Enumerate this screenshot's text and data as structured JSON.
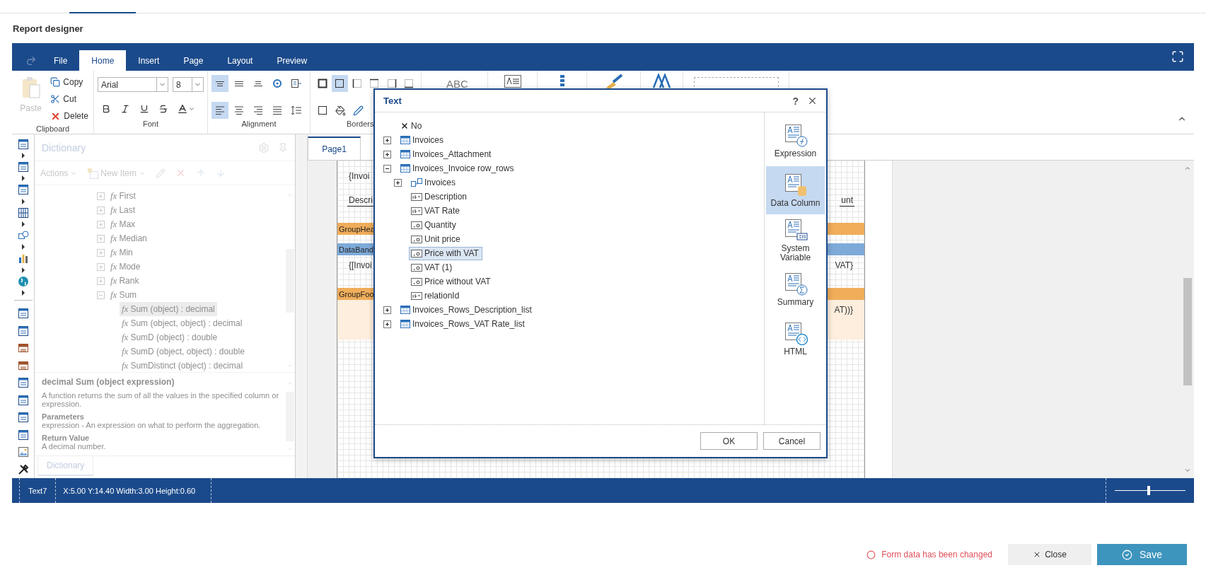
{
  "page_title": "Report designer",
  "ribbon_tabs": [
    {
      "label": "File",
      "selected": false
    },
    {
      "label": "Home",
      "selected": true
    },
    {
      "label": "Insert",
      "selected": false
    },
    {
      "label": "Page",
      "selected": false
    },
    {
      "label": "Layout",
      "selected": false
    },
    {
      "label": "Preview",
      "selected": false
    }
  ],
  "clipboard": {
    "title": "Clipboard",
    "paste": {
      "label": "Paste",
      "disabled": true
    },
    "actions": [
      {
        "kind": "copy",
        "label": "Copy"
      },
      {
        "kind": "cut",
        "label": "Cut"
      },
      {
        "kind": "delete",
        "label": "Delete"
      }
    ]
  },
  "font": {
    "title": "Font",
    "family": "Arial",
    "size": "8",
    "buttons": [
      {
        "kind": "bold",
        "selected": false
      },
      {
        "kind": "italic",
        "selected": false
      },
      {
        "kind": "underline",
        "selected": false
      },
      {
        "kind": "strike",
        "selected": false
      },
      {
        "kind": "color",
        "selected": false
      }
    ]
  },
  "alignment": {
    "title": "Alignment",
    "rows": [
      [
        {
          "kind": "top",
          "selected": true
        },
        {
          "kind": "middle",
          "selected": false
        },
        {
          "kind": "bottom",
          "selected": false
        },
        {
          "kind": "rotate",
          "selected": false
        },
        {
          "kind": "wrap",
          "selected": false
        }
      ],
      [
        {
          "kind": "left",
          "selected": true
        },
        {
          "kind": "center",
          "selected": false
        },
        {
          "kind": "right",
          "selected": false
        },
        {
          "kind": "justify",
          "selected": false
        },
        {
          "kind": "spacing",
          "selected": false
        }
      ]
    ]
  },
  "borders": {
    "title": "Borders",
    "rows": [
      [
        {
          "kind": "all",
          "selected": false
        },
        {
          "kind": "frame",
          "selected": true
        },
        {
          "kind": "left",
          "selected": false
        },
        {
          "kind": "top",
          "selected": false
        },
        {
          "kind": "right",
          "selected": false
        },
        {
          "kind": "bottom",
          "selected": false
        }
      ],
      [
        {
          "kind": "none",
          "selected": false
        },
        {
          "kind": "fill",
          "selected": false
        },
        {
          "kind": "pen",
          "selected": false
        }
      ]
    ]
  },
  "styles": {
    "label": "ABC"
  },
  "dictionary": {
    "title": "Dictionary",
    "actions": "Actions",
    "new_item": "New Item",
    "items": [
      {
        "glyph": "fx",
        "label": "First",
        "expanded": false,
        "selected": false
      },
      {
        "glyph": "fx",
        "label": "Last",
        "expanded": false,
        "selected": false
      },
      {
        "glyph": "fx",
        "label": "Max",
        "expanded": false,
        "selected": false
      },
      {
        "glyph": "fx",
        "label": "Median",
        "expanded": false,
        "selected": false
      },
      {
        "glyph": "fx",
        "label": "Min",
        "expanded": false,
        "selected": false
      },
      {
        "glyph": "fx",
        "label": "Mode",
        "expanded": false,
        "selected": false
      },
      {
        "glyph": "fx",
        "label": "Rank",
        "expanded": false,
        "selected": false
      },
      {
        "glyph": "fx",
        "label": "Sum",
        "expanded": true,
        "selected": false,
        "children": [
          {
            "glyph": "fx",
            "label": "Sum (object) : decimal",
            "selected": true
          },
          {
            "glyph": "fx",
            "label": "Sum (object, object) : decimal",
            "selected": false
          },
          {
            "glyph": "fx",
            "label": "SumD (object) : double",
            "selected": false
          },
          {
            "glyph": "fx",
            "label": "SumD (object, object) : double",
            "selected": false
          },
          {
            "glyph": "fx",
            "label": "SumDistinct (object) : decimal",
            "selected": false
          }
        ]
      }
    ],
    "description": {
      "heading": "decimal Sum (object expression)",
      "text": "A function returns the sum of all the values in the specified column or expression.",
      "sections": [
        {
          "title": "Parameters",
          "text": "expression - An expression on what to perform the aggregation."
        },
        {
          "title": "Return Value",
          "text": "A decimal number."
        }
      ]
    },
    "tab": {
      "label": "Dictionary",
      "selected": true
    }
  },
  "page_tab": {
    "label": "Page1",
    "selected": true
  },
  "report_rows": [
    {
      "kind": "field_row",
      "left": "{Invoi",
      "underlined": false
    },
    {
      "kind": "field_row",
      "left": "Descri",
      "right": "unt",
      "underlined": true
    },
    {
      "kind": "band",
      "left": "GroupHea",
      "color": "#f0ad5a"
    },
    {
      "kind": "band",
      "left": "DataBand",
      "color": "#7eaad9"
    },
    {
      "kind": "field_row",
      "left": "{[Invoi",
      "right": "VAT}",
      "underlined": false
    },
    {
      "kind": "band",
      "left": "GroupFoo",
      "color": "#f0ad5a"
    },
    {
      "kind": "field_row",
      "right": "AT))}",
      "underlined": false,
      "color": "#fdeedd"
    }
  ],
  "dialog": {
    "title": "Text",
    "help": "?",
    "tree": [
      {
        "kind": "none",
        "label": "No",
        "selected": false
      },
      {
        "kind": "table",
        "label": "Invoices",
        "expanded": false,
        "selected": false
      },
      {
        "kind": "table",
        "label": "Invoices_Attachment",
        "expanded": false,
        "selected": false
      },
      {
        "kind": "table",
        "label": "Invoices_Invoice row_rows",
        "expanded": true,
        "selected": false,
        "children": [
          {
            "kind": "relation",
            "label": "Invoices",
            "expanded": false,
            "selected": false
          },
          {
            "kind": "text",
            "label": "Description",
            "selected": false
          },
          {
            "kind": "text",
            "label": "VAT Rate",
            "selected": false
          },
          {
            "kind": "number",
            "label": "Quantity",
            "selected": false
          },
          {
            "kind": "number",
            "label": "Unit price",
            "selected": false
          },
          {
            "kind": "number",
            "label": "Price with VAT",
            "selected": true
          },
          {
            "kind": "number",
            "label": "VAT (1)",
            "selected": false
          },
          {
            "kind": "number",
            "label": "Price without VAT",
            "selected": false
          },
          {
            "kind": "text",
            "label": "relationId",
            "selected": false
          }
        ]
      },
      {
        "kind": "table",
        "label": "Invoices_Rows_Description_list",
        "expanded": false,
        "selected": false
      },
      {
        "kind": "table",
        "label": "Invoices_Rows_VAT Rate_list",
        "expanded": false,
        "selected": false
      }
    ],
    "categories": [
      {
        "kind": "expression",
        "label": "Expression",
        "selected": false
      },
      {
        "kind": "column",
        "label": "Data Column",
        "selected": true
      },
      {
        "kind": "variable",
        "label": "System Variable",
        "selected": false
      },
      {
        "kind": "summary",
        "label": "Summary",
        "selected": false
      },
      {
        "kind": "html",
        "label": "HTML",
        "selected": false
      }
    ],
    "buttons": [
      "OK",
      "Cancel"
    ]
  },
  "status_bar": {
    "component": "Text7",
    "position": "X:5.00 Y:14.40 Width:3.00 Height:0.60",
    "zoom": {
      "level": 0.48
    }
  },
  "footer": {
    "message": "Form data has been changed",
    "close": "Close",
    "save": "Save"
  }
}
